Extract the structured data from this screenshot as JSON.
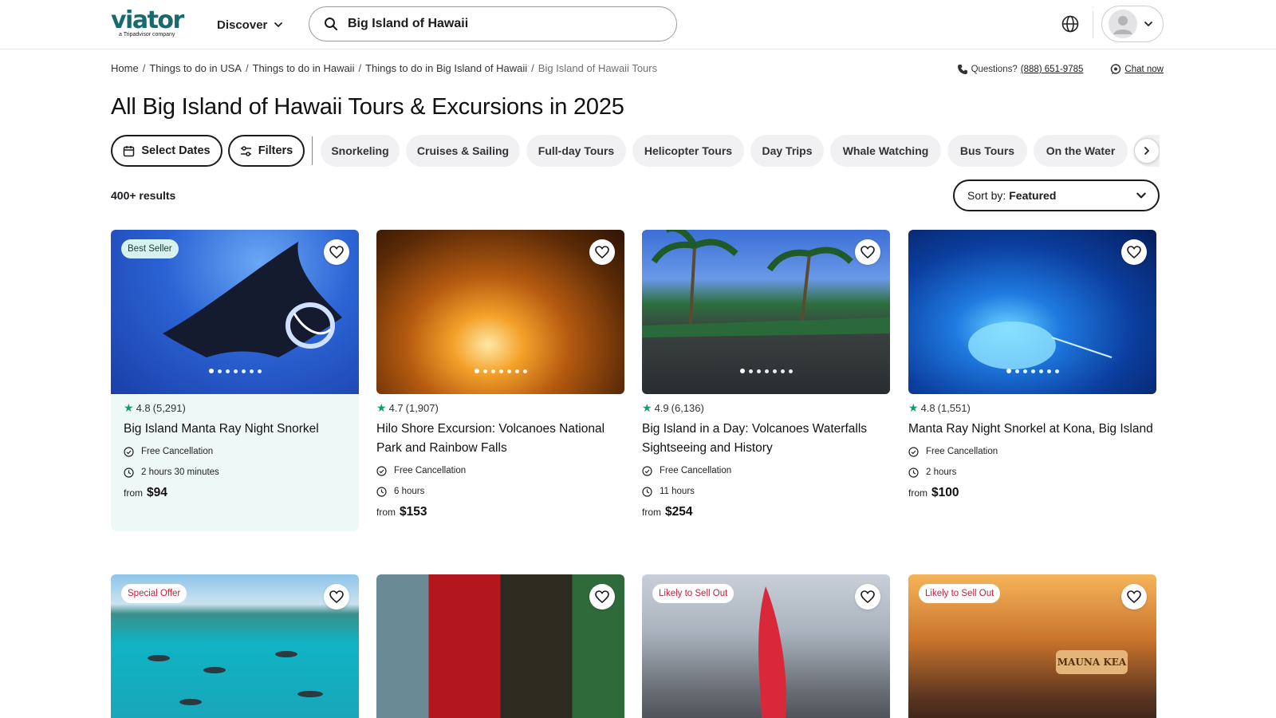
{
  "header": {
    "logo_text": "viator",
    "logo_sub": "a Tripadvisor company",
    "discover_label": "Discover",
    "search_value": "Big Island of Hawaii"
  },
  "breadcrumb": [
    "Home",
    "Things to do in USA",
    "Things to do in Hawaii",
    "Things to do in Big Island of Hawaii",
    "Big Island of Hawaii Tours"
  ],
  "help": {
    "questions_label": "Questions?",
    "phone": "(888) 651-9785",
    "chat_label": "Chat now"
  },
  "page_title": "All Big Island of Hawaii Tours & Excursions in 2025",
  "filters": {
    "select_dates_label": "Select Dates",
    "filters_label": "Filters",
    "chips": [
      "Snorkeling",
      "Cruises & Sailing",
      "Full-day Tours",
      "Helicopter Tours",
      "Day Trips",
      "Whale Watching",
      "Bus Tours",
      "On the Water"
    ]
  },
  "results_count": "400+ results",
  "sort": {
    "label": "Sort by:",
    "value": "Featured"
  },
  "cards": [
    {
      "badge": "Best Seller",
      "rating": "4.8",
      "reviews": "(5,291)",
      "title": "Big Island Manta Ray Night Snorkel",
      "cancellation": "Free Cancellation",
      "duration": "2 hours 30 minutes",
      "price_from": "from",
      "price": "$94"
    },
    {
      "badge": "",
      "rating": "4.7",
      "reviews": "(1,907)",
      "title": "Hilo Shore Excursion: Volcanoes National Park and Rainbow Falls",
      "cancellation": "Free Cancellation",
      "duration": "6 hours",
      "price_from": "from",
      "price": "$153"
    },
    {
      "badge": "",
      "rating": "4.9",
      "reviews": "(6,136)",
      "title": "Big Island in a Day: Volcanoes Waterfalls Sightseeing and History",
      "cancellation": "Free Cancellation",
      "duration": "11 hours",
      "price_from": "from",
      "price": "$254"
    },
    {
      "badge": "",
      "rating": "4.8",
      "reviews": "(1,551)",
      "title": "Manta Ray Night Snorkel at Kona, Big Island",
      "cancellation": "Free Cancellation",
      "duration": "2 hours",
      "price_from": "from",
      "price": "$100"
    },
    {
      "badge": "Special Offer"
    },
    {
      "badge": ""
    },
    {
      "badge": "Likely to Sell Out"
    },
    {
      "badge": "Likely to Sell Out",
      "image_sign": "MAUNA KEA"
    }
  ],
  "colors": {
    "brand": "#186b6d",
    "star": "#0f9d76",
    "alert": "#c31d3a",
    "highlight_bg": "#eef8f6"
  }
}
